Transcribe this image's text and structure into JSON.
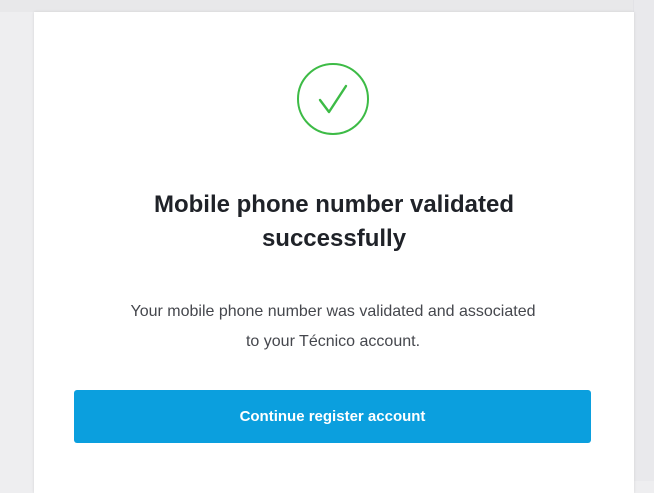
{
  "colors": {
    "success_green": "#3dbb46",
    "primary_blue": "#0b9fde",
    "title_text": "#1f2228",
    "body_text": "#45474d"
  },
  "icon": {
    "name": "check-circle-icon"
  },
  "confirmation": {
    "title_line_1": "Mobile phone number validated",
    "title_line_2": "successfully",
    "message_line_1": "Your mobile phone number was validated and associated",
    "message_line_2": "to your Técnico account."
  },
  "actions": {
    "continue_label": "Continue register account"
  }
}
